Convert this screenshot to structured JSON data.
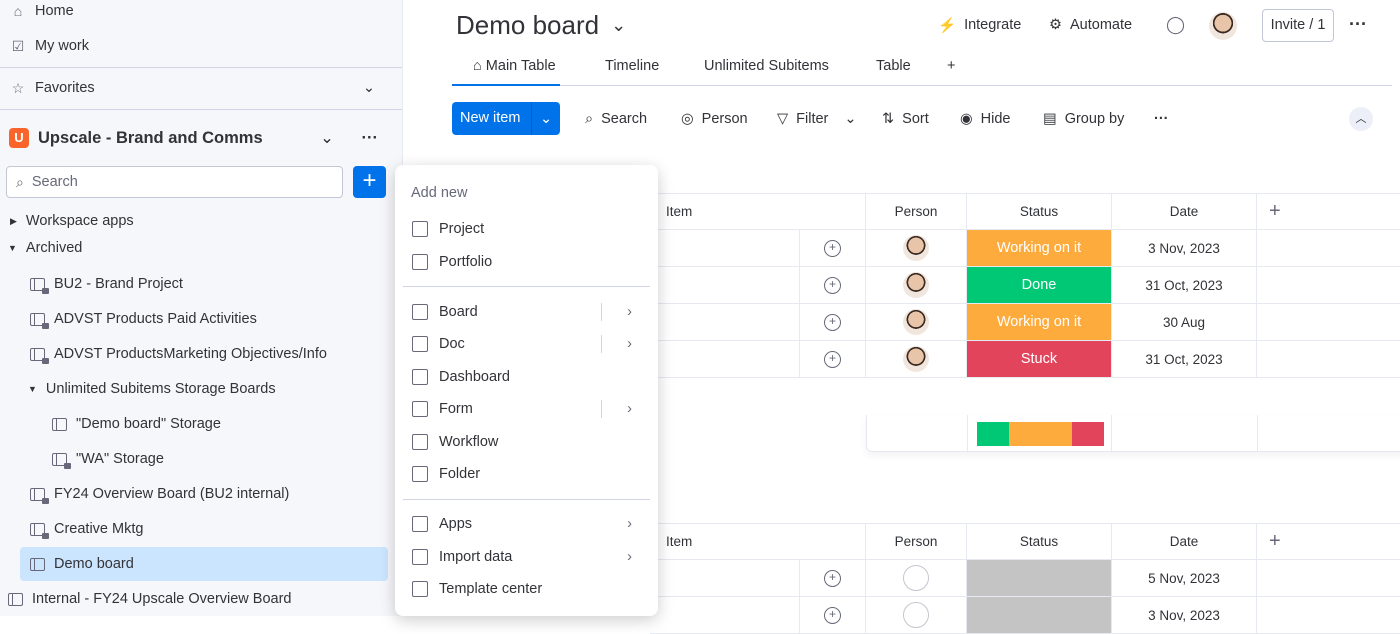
{
  "sidebar": {
    "home": "Home",
    "my_work": "My work",
    "favorites": "Favorites",
    "workspace": "Upscale - Brand and Comms",
    "search_placeholder": "Search",
    "workspace_apps": "Workspace apps",
    "archived": "Archived",
    "items": [
      {
        "label": "BU2 - Brand Project",
        "locked": true
      },
      {
        "label": "ADVST Products Paid Activities",
        "locked": true
      },
      {
        "label": "ADVST ProductsMarketing Objectives/Info",
        "locked": true
      },
      {
        "label": "Unlimited Subitems Storage Boards",
        "folder": true
      },
      {
        "label": "\"Demo board\" Storage"
      },
      {
        "label": "\"WA\" Storage",
        "locked": true
      },
      {
        "label": "FY24 Overview Board (BU2 internal)",
        "locked": true
      },
      {
        "label": "Creative Mktg",
        "locked": true
      },
      {
        "label": "Demo board",
        "selected": true
      },
      {
        "label": "Internal - FY24 Upscale Overview Board"
      }
    ]
  },
  "header": {
    "title": "Demo board",
    "integrate": "Integrate",
    "automate": "Automate",
    "invite": "Invite / 1"
  },
  "tabs": [
    "Main Table",
    "Timeline",
    "Unlimited Subitems",
    "Table",
    "+"
  ],
  "toolbar": {
    "new_item": "New item",
    "search": "Search",
    "person": "Person",
    "filter": "Filter",
    "sort": "Sort",
    "hide": "Hide",
    "group_by": "Group by"
  },
  "table1": {
    "headers": [
      "Item",
      "Person",
      "Status",
      "Date"
    ],
    "rows": [
      {
        "status": "Working on it",
        "status_color": "#fdab3d",
        "date": "3 Nov, 2023"
      },
      {
        "status": "Done",
        "status_color": "#00c875",
        "date": "31 Oct, 2023"
      },
      {
        "status": "Working on it",
        "status_color": "#fdab3d",
        "date": "30 Aug"
      },
      {
        "status": "Stuck",
        "status_color": "#e2445c",
        "date": "31 Oct, 2023"
      }
    ],
    "summary": [
      {
        "color": "#00c875",
        "fraction": 0.25
      },
      {
        "color": "#fdab3d",
        "fraction": 0.5
      },
      {
        "color": "#e2445c",
        "fraction": 0.25
      }
    ]
  },
  "table2": {
    "headers": [
      "Item",
      "Person",
      "Status",
      "Date"
    ],
    "rows": [
      {
        "status": "",
        "status_color": "#c4c4c4",
        "date": "5 Nov, 2023"
      },
      {
        "status": "",
        "status_color": "#c4c4c4",
        "date": "3 Nov, 2023"
      }
    ]
  },
  "menu": {
    "title": "Add new",
    "items": [
      {
        "label": "Project"
      },
      {
        "label": "Portfolio"
      },
      {
        "label": "Board",
        "sub": true,
        "split": true
      },
      {
        "label": "Doc",
        "sub": true,
        "split": true
      },
      {
        "label": "Dashboard"
      },
      {
        "label": "Form",
        "sub": true,
        "split": true
      },
      {
        "label": "Workflow"
      },
      {
        "label": "Folder"
      },
      {
        "label": "Apps",
        "sub": true
      },
      {
        "label": "Import data",
        "sub": true
      },
      {
        "label": "Template center"
      }
    ]
  },
  "colors": {
    "accent": "#0073ea",
    "selected": "#cce5ff"
  }
}
